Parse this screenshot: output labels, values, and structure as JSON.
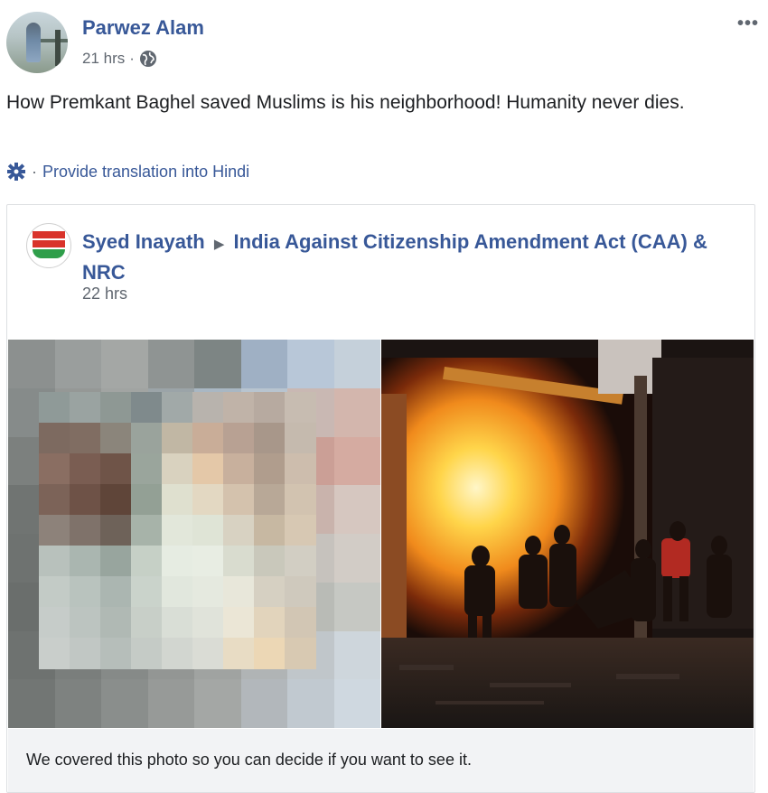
{
  "post": {
    "author": "Parwez Alam",
    "time": "21 hrs",
    "separator": "·",
    "privacy_icon": "globe-icon",
    "more_icon": "more-options-icon",
    "more_label": "•••",
    "text": "How Premkant Baghel saved Muslims is his neighborhood! Humanity never dies.",
    "translate": {
      "icon": "gear-icon",
      "separator": "·",
      "label": "Provide translation into Hindi"
    }
  },
  "shared": {
    "author": "Syed Inayath",
    "arrow": "▶",
    "group": "India Against Citizenship Amendment Act (CAA) & NRC",
    "time": "22 hrs",
    "cover_notice": "We covered this photo so you can decide if you want to see it."
  },
  "colors": {
    "link_blue": "#385898",
    "meta_gray": "#606770",
    "text": "#1c1e21",
    "notice_bg": "#f2f3f5"
  }
}
